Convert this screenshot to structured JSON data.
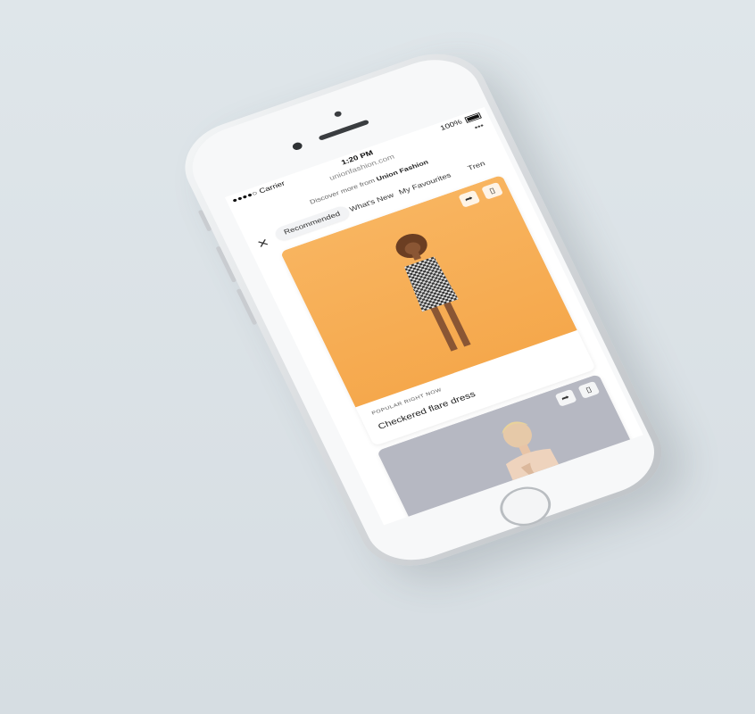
{
  "status_bar": {
    "carrier": "●●●●○ Carrier",
    "time": "1:20 PM",
    "battery": "100%"
  },
  "browser": {
    "url": "unionfashion.com",
    "more": "•••"
  },
  "header": {
    "discover_prefix": "Discover more from",
    "brand": "Union Fashion"
  },
  "tabs": [
    {
      "label": "Recommended",
      "active": true
    },
    {
      "label": "What's New",
      "active": false
    },
    {
      "label": "My Favourites",
      "active": false
    },
    {
      "label": "Tren",
      "active": false
    }
  ],
  "close_glyph": "✕",
  "cards": [
    {
      "label": "POPULAR RIGHT NOW",
      "title": "Checkered flare dress",
      "background": "#f5a84c",
      "share_icon": "share-icon",
      "bookmark_icon": "bookmark-icon"
    },
    {
      "background": "#b6b8c2",
      "share_icon": "share-icon",
      "bookmark_icon": "bookmark-icon"
    }
  ],
  "colors": {
    "page_bg": "#d9e0e4",
    "card1_bg": "#f5a84c",
    "card2_bg": "#b6b8c2"
  }
}
